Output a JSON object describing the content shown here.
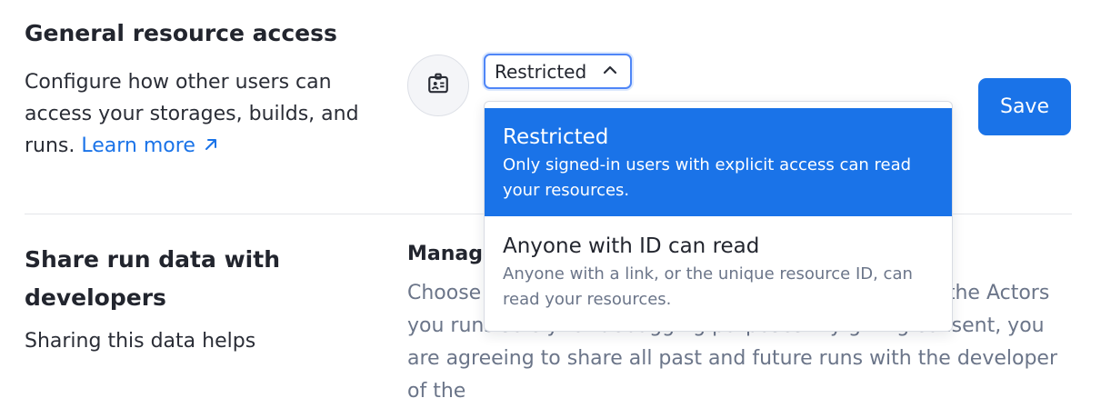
{
  "general_access": {
    "title": "General resource access",
    "description": "Configure how other users can access your storages, builds, and runs.",
    "learn_more": "Learn more",
    "select_value": "Restricted",
    "save_label": "Save"
  },
  "dropdown": {
    "options": [
      {
        "label": "Restricted",
        "help": "Only signed-in users with explicit access can read your resources.",
        "selected": true
      },
      {
        "label": "Anyone with ID can read",
        "help": "Anyone with a link, or the unique resource ID, can read your resources.",
        "selected": false
      }
    ]
  },
  "share_run_data": {
    "title": "Share run data with developers",
    "description": "Sharing this data helps",
    "subheading": "Manage",
    "body": "Choose whether to share run data with developers of the Actors you runs solely for debugging purposes. By giving consent, you are agreeing to share all past and future runs with the developer of the"
  },
  "colors": {
    "accent": "#1a73e8",
    "muted_text": "#6b7589",
    "divider": "#e4e6ea"
  },
  "icons": {
    "access": "id-badge-icon",
    "link": "external-link-arrow-icon",
    "select": "chevron-up-icon"
  }
}
